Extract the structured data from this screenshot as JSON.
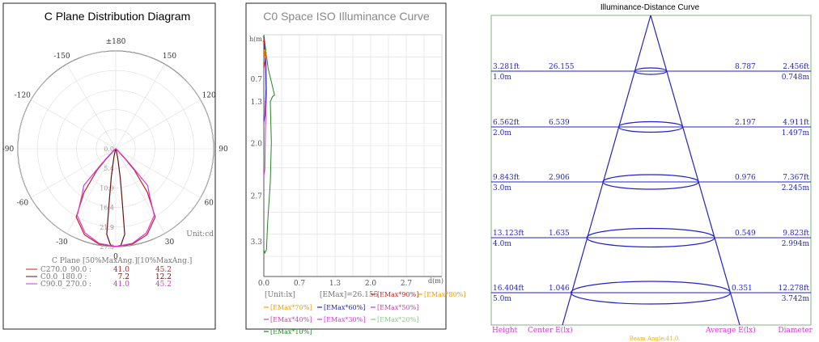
{
  "colors": {
    "red": "#cc2222",
    "darkred": "#6a1010",
    "magenta": "#dd33dd",
    "blue": "#2222cc",
    "green": "#228822",
    "orange": "#ff9900",
    "pink": "#cc44aa",
    "lightgreen": "#88cc88",
    "grid": "#cccccc",
    "axis": "#888888"
  },
  "chart_data": [
    {
      "type": "polar",
      "title": "C Plane Distribution Diagram",
      "angle_labels": [
        "±180",
        "150",
        "120",
        "90",
        "60",
        "30",
        "0",
        "-30",
        "-60",
        "-90",
        "-120",
        "-150"
      ],
      "radial_labels": [
        "0.0",
        "5.4",
        "10.9",
        "16.4",
        "21.9",
        "27.3"
      ],
      "unit": "Unit:cd",
      "table_header": "C Plane  [50%MaxAng.][10%MaxAng.]",
      "series": [
        {
          "name": "C270.0_90.0 :",
          "v50": "41.0",
          "v10": "45.2",
          "color": "red",
          "profile": [
            [
              0,
              27.3
            ],
            [
              10,
              27.0
            ],
            [
              20,
              25.5
            ],
            [
              30,
              22.0
            ],
            [
              36,
              15.0
            ],
            [
              41,
              8.0
            ],
            [
              43,
              4.0
            ],
            [
              45.2,
              1.0
            ],
            [
              50,
              0.2
            ],
            [
              60,
              0.05
            ]
          ]
        },
        {
          "name": "C0.0_180.0 :",
          "v50": "7.2",
          "v10": "12.2",
          "color": "darkred",
          "profile": [
            [
              0,
              27.3
            ],
            [
              3,
              27.0
            ],
            [
              6,
              24.0
            ],
            [
              7.2,
              13.6
            ],
            [
              9,
              8.0
            ],
            [
              12.2,
              2.7
            ],
            [
              15,
              0.8
            ],
            [
              20,
              0.1
            ]
          ]
        },
        {
          "name": "C90.0_270.0 :",
          "v50": "41.0",
          "v10": "45.2",
          "color": "magenta",
          "profile": [
            [
              0,
              27.3
            ],
            [
              10,
              26.8
            ],
            [
              20,
              25.0
            ],
            [
              30,
              21.5
            ],
            [
              36,
              16.0
            ],
            [
              41,
              13.6
            ],
            [
              43,
              6.0
            ],
            [
              45.2,
              2.7
            ],
            [
              50,
              0.5
            ],
            [
              60,
              0.05
            ]
          ]
        }
      ]
    },
    {
      "type": "line",
      "title": "C0 Space ISO Illuminance Curve",
      "xlabel": "d(m)",
      "ylabel": "h(m)",
      "x_ticks": [
        "0.0",
        "0.7",
        "1.3",
        "2.0",
        "2.7"
      ],
      "y_ticks": [
        "0.7",
        "1.3",
        "2.0",
        "2.7",
        "3.3"
      ],
      "xlim": [
        0,
        3.3
      ],
      "ylim": [
        0,
        3.6
      ],
      "unit": "[Unit:lx]",
      "emax": "[EMax]=26.155",
      "legend": [
        {
          "label": "[EMax*90%]",
          "color": "red"
        },
        {
          "label": "[EMax*80%]",
          "color": "orange"
        },
        {
          "label": "[EMax*70%]",
          "color": "orange"
        },
        {
          "label": "[EMax*60%]",
          "color": "blue"
        },
        {
          "label": "[EMax*50%]",
          "color": "pink"
        },
        {
          "label": "[EMax*40%]",
          "color": "pink"
        },
        {
          "label": "[EMax*30%]",
          "color": "magenta"
        },
        {
          "label": "[EMax*20%]",
          "color": "lightgreen"
        },
        {
          "label": "[EMax*10%]",
          "color": "green"
        }
      ],
      "series": [
        {
          "color": "green",
          "points": [
            [
              0,
              0
            ],
            [
              0.08,
              0.5
            ],
            [
              0.2,
              0.9
            ],
            [
              0.16,
              0.92
            ],
            [
              0.12,
              1.0
            ],
            [
              0.14,
              1.6
            ],
            [
              0.12,
              2.2
            ],
            [
              0.07,
              2.8
            ],
            [
              0.05,
              3.2
            ],
            [
              0.02,
              3.25
            ],
            [
              0,
              3.2
            ]
          ]
        },
        {
          "color": "magenta",
          "points": [
            [
              0,
              0.05
            ],
            [
              0.04,
              0.4
            ],
            [
              0.05,
              0.9
            ],
            [
              0.03,
              1.4
            ],
            [
              0.02,
              2.0
            ],
            [
              0,
              2.1
            ]
          ]
        },
        {
          "color": "blue",
          "points": [
            [
              0,
              0.05
            ],
            [
              0.03,
              0.4
            ],
            [
              0.04,
              0.8
            ],
            [
              0.02,
              1.2
            ],
            [
              0,
              1.3
            ]
          ]
        },
        {
          "color": "red",
          "points": [
            [
              0,
              0.05
            ],
            [
              0.02,
              0.2
            ],
            [
              0.03,
              0.35
            ],
            [
              0.01,
              0.45
            ],
            [
              0,
              0.5
            ]
          ]
        },
        {
          "color": "orange",
          "points": [
            [
              0.01,
              0.22
            ],
            [
              0.05,
              0.26
            ],
            [
              0.04,
              0.34
            ],
            [
              0.01,
              0.32
            ],
            [
              0.01,
              0.22
            ]
          ]
        }
      ]
    },
    {
      "type": "cone",
      "title": "Illuminance-Distance Curve",
      "rows": [
        {
          "height_ft": "3.281ft",
          "height_m": "1.0m",
          "center": "26.155",
          "average": "8.787",
          "diameter_ft": "2.456ft",
          "diameter_m": "0.748m"
        },
        {
          "height_ft": "6.562ft",
          "height_m": "2.0m",
          "center": "6.539",
          "average": "2.197",
          "diameter_ft": "4.911ft",
          "diameter_m": "1.497m"
        },
        {
          "height_ft": "9.843ft",
          "height_m": "3.0m",
          "center": "2.906",
          "average": "0.976",
          "diameter_ft": "7.367ft",
          "diameter_m": "2.245m"
        },
        {
          "height_ft": "13.123ft",
          "height_m": "4.0m",
          "center": "1.635",
          "average": "0.549",
          "diameter_ft": "9.823ft",
          "diameter_m": "2.994m"
        },
        {
          "height_ft": "16.404ft",
          "height_m": "5.0m",
          "center": "1.046",
          "average": "0.351",
          "diameter_ft": "12.278ft",
          "diameter_m": "3.742m"
        }
      ],
      "footer": {
        "height": "Height",
        "center": "Center E(lx)",
        "average": "Average E(lx)",
        "diameter": "Diameter"
      },
      "beam_angle": "Beam Angle:41.0"
    }
  ]
}
